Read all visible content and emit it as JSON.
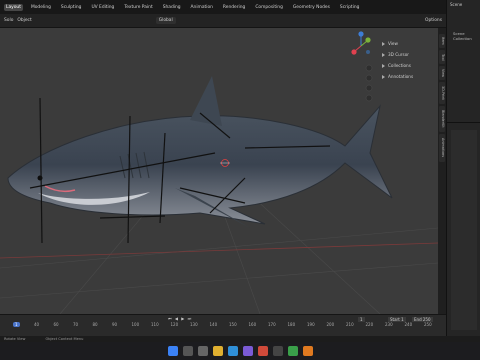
{
  "topbar": {
    "workspaces": [
      "Layout",
      "Modeling",
      "Sculpting",
      "UV Editing",
      "Texture Paint",
      "Shading",
      "Animation",
      "Rendering",
      "Compositing",
      "Geometry Nodes",
      "Scripting"
    ],
    "scene_label": "Scene"
  },
  "viewport_header": {
    "mode": "Solo",
    "view_menu": "Object",
    "orientation": "Global",
    "options": "Options"
  },
  "overlay_menu": [
    "View",
    "3D Cursor",
    "Collections",
    "Annotations"
  ],
  "sidebar_tabs": [
    "Item",
    "Tool",
    "View",
    "3D-Print",
    "BlenderKit",
    "Animations"
  ],
  "outliner": {
    "title": "Scene Collection"
  },
  "timeline": {
    "current_frame": "1",
    "start_label": "Start",
    "start": "1",
    "end_label": "End",
    "end": "250",
    "ticks": [
      "40",
      "60",
      "70",
      "80",
      "90",
      "100",
      "110",
      "120",
      "130",
      "140",
      "150",
      "160",
      "170",
      "180",
      "190",
      "200",
      "210",
      "220",
      "230",
      "240",
      "250"
    ]
  },
  "statusbar": {
    "left": "Rotate View",
    "right": "Object Context Menu"
  },
  "colors": {
    "x_axis": "#e0414f",
    "y_axis": "#7bb23a",
    "z_axis": "#3d7dd6",
    "active_tab": "#474747"
  }
}
